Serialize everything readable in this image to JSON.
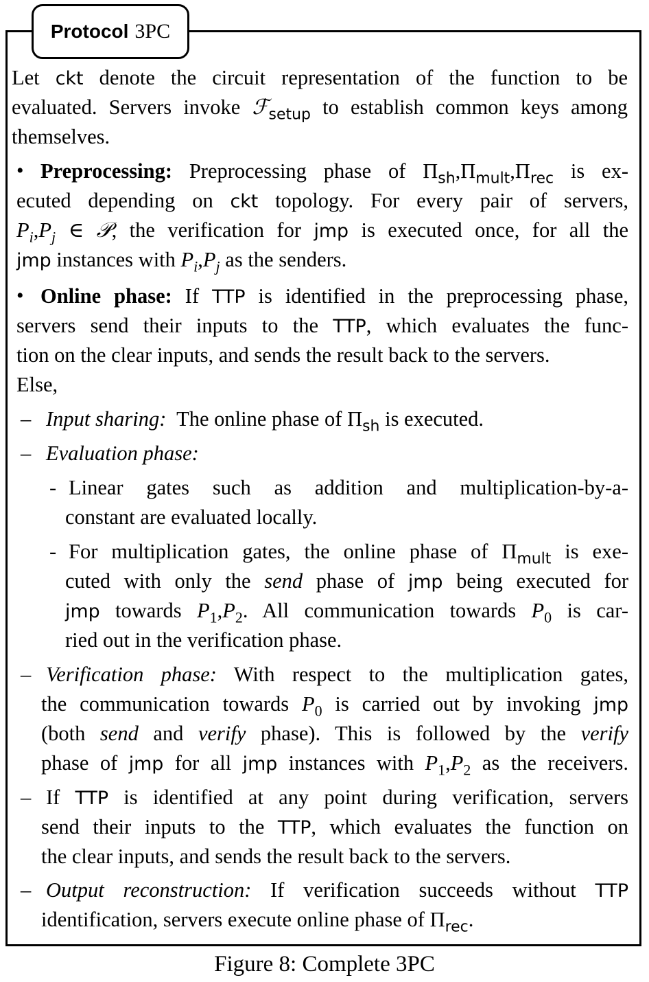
{
  "protocol": {
    "title_label": "Protocol",
    "title_name": "3PC"
  },
  "intro": {
    "l1": "Let ckt denote the circuit representation of the function to be",
    "l2": "evaluated. Servers invoke ℱsetup to establish common keys among",
    "l3": "themselves."
  },
  "preprocessing": {
    "heading": "Preprocessing:",
    "l1": "Preprocessing phase of Πsh, Πmult, Πrec is ex-",
    "l2": "ecuted depending on ckt topology. For every pair of servers,",
    "l3": "Pi, Pj ∈ 𝒫, the verification for jmp is executed once, for all the",
    "l4": "jmp instances with Pi, Pj as the senders."
  },
  "online": {
    "heading": "Online phase:",
    "l1": "If TTP is identified in the preprocessing phase,",
    "l2": "servers send their inputs to the TTP, which evaluates the func-",
    "l3": "tion on the clear inputs, and sends the result back to the servers.",
    "l4": "Else,"
  },
  "input_sharing": {
    "dash": "–",
    "heading": "Input sharing:",
    "text": "The online phase of Πsh is executed."
  },
  "evaluation": {
    "dash": "–",
    "heading": "Evaluation phase:",
    "sub_dash": "-",
    "linear_l1": "Linear gates such as addition and multiplication-by-a-",
    "linear_l2": "constant are evaluated locally.",
    "mult_l1": "For multiplication gates, the online phase of Πmult is exe-",
    "mult_l2": "cuted with only the send phase of jmp being executed for",
    "mult_l3": "jmp towards P1, P2. All communication towards P0 is car-",
    "mult_l4": "ried out in the verification phase."
  },
  "verification": {
    "dash": "–",
    "heading": "Verification phase:",
    "l1": "With respect to the multiplication gates,",
    "l2": "the communication towards P0 is carried out by invoking jmp",
    "l3": "(both send and verify phase). This is followed by the verify",
    "l4": "phase of jmp for all jmp instances with P1, P2 as the receivers."
  },
  "ttp_clause": {
    "dash": "–",
    "l1": "If TTP is identified at any point during verification, servers",
    "l2": "send their inputs to the TTP, which evaluates the function on",
    "l3": "the clear inputs, and sends the result back to the servers."
  },
  "output": {
    "dash": "–",
    "heading": "Output reconstruction:",
    "l1": "If verification succeeds without TTP",
    "l2": "identification, servers execute online phase of Πrec."
  },
  "caption": {
    "label": "Figure 8:",
    "text": "Complete 3PC"
  }
}
